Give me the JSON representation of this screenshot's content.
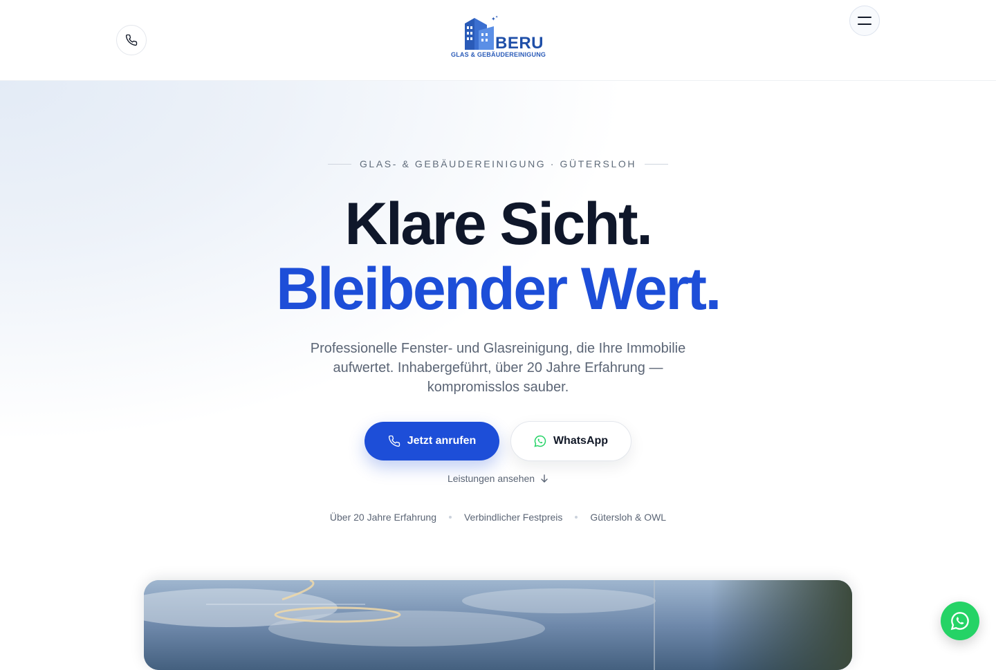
{
  "header": {
    "logo_word": "BERU",
    "logo_subline": "GLAS & GEBÄUDEREINIGUNG",
    "phone_icon": "phone-icon",
    "menu_icon": "hamburger-icon"
  },
  "hero": {
    "eyebrow": "GLAS- & GEBÄUDEREINIGUNG · GÜTERSLOH",
    "headline_line1": "Klare Sicht.",
    "headline_line2": "Bleibender Wert.",
    "subtext": "Professionelle Fenster- und Glasreinigung, die Ihre Immobilie aufwertet. Inhabergeführt, über 20 Jahre Erfahrung — kompromisslos sauber.",
    "cta_call_label": "Jetzt anrufen",
    "cta_whatsapp_label": "WhatsApp",
    "services_link": "Leistungen ansehen",
    "badges": [
      "Über 20 Jahre Erfahrung",
      "Verbindlicher Festpreis",
      "Gütersloh & OWL"
    ]
  },
  "colors": {
    "accent": "#1d4ed8",
    "headline_dark": "#0f172a",
    "whatsapp_green": "#25d366",
    "muted_text": "#5b6575"
  },
  "floating": {
    "whatsapp_icon": "whatsapp-icon"
  }
}
